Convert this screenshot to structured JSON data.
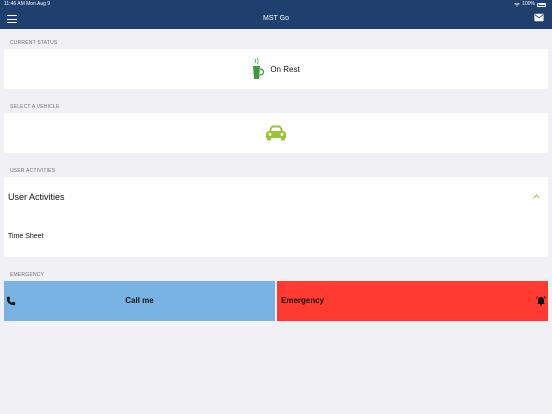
{
  "statusbar": {
    "time": "11:46 AM  Mon Aug 9",
    "battery": "100%"
  },
  "navbar": {
    "title": "MST Go",
    "menu_icon": "hamburger-icon",
    "mail_icon": "envelope-icon"
  },
  "current_status": {
    "section_label": "CURRENT STATUS",
    "status": "On Rest",
    "icon": "coffee-cup-icon",
    "icon_color": "#3d9b3d"
  },
  "vehicle": {
    "section_label": "SELECT A VEHICLE",
    "icon": "car-icon",
    "icon_color": "#9ac33c"
  },
  "user_activities": {
    "section_label": "USER ACTIVITIES",
    "title": "User Activities",
    "expanded": true,
    "chevron_color": "#9ac33c",
    "items": [
      "Time Sheet"
    ]
  },
  "emergency": {
    "section_label": "EMERGENCY",
    "call_label": "Call me",
    "call_color": "#78b3e3",
    "emergency_label": "Emergency",
    "emergency_color": "#ff3a30"
  }
}
